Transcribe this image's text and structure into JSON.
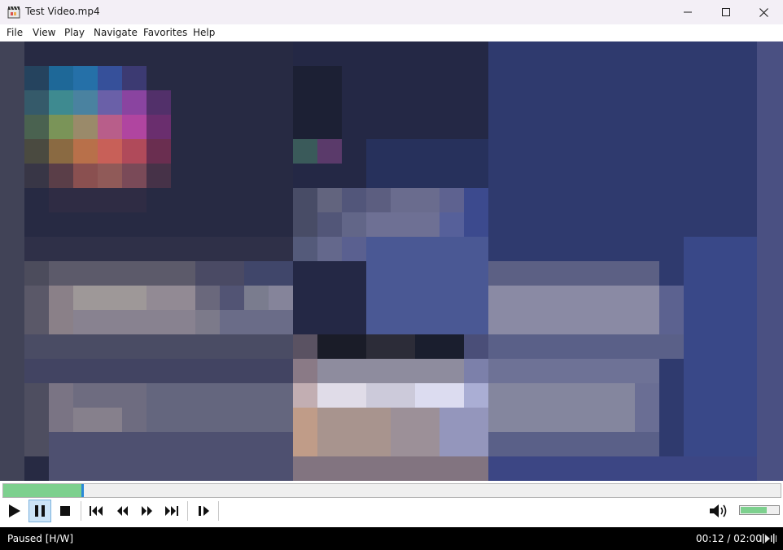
{
  "window": {
    "title": "Test Video.mp4"
  },
  "menu": [
    "File",
    "View",
    "Play",
    "Navigate",
    "Favorites",
    "Help"
  ],
  "playback": {
    "position_fraction": 0.1,
    "volume_fraction": 0.7
  },
  "status": {
    "state": "Paused [H/W]",
    "time": "00:12 / 02:00"
  },
  "colors": {
    "seek_fill": "#7dd08e",
    "seek_thumb": "#2b88d8",
    "active_button": "#cce4f7",
    "status_bg": "#000000"
  },
  "controls": [
    "play-icon",
    "pause-icon",
    "stop-icon",
    "skip-previous-icon",
    "rewind-icon",
    "fast-forward-icon",
    "skip-next-icon",
    "frame-step-icon",
    "volume-icon"
  ]
}
